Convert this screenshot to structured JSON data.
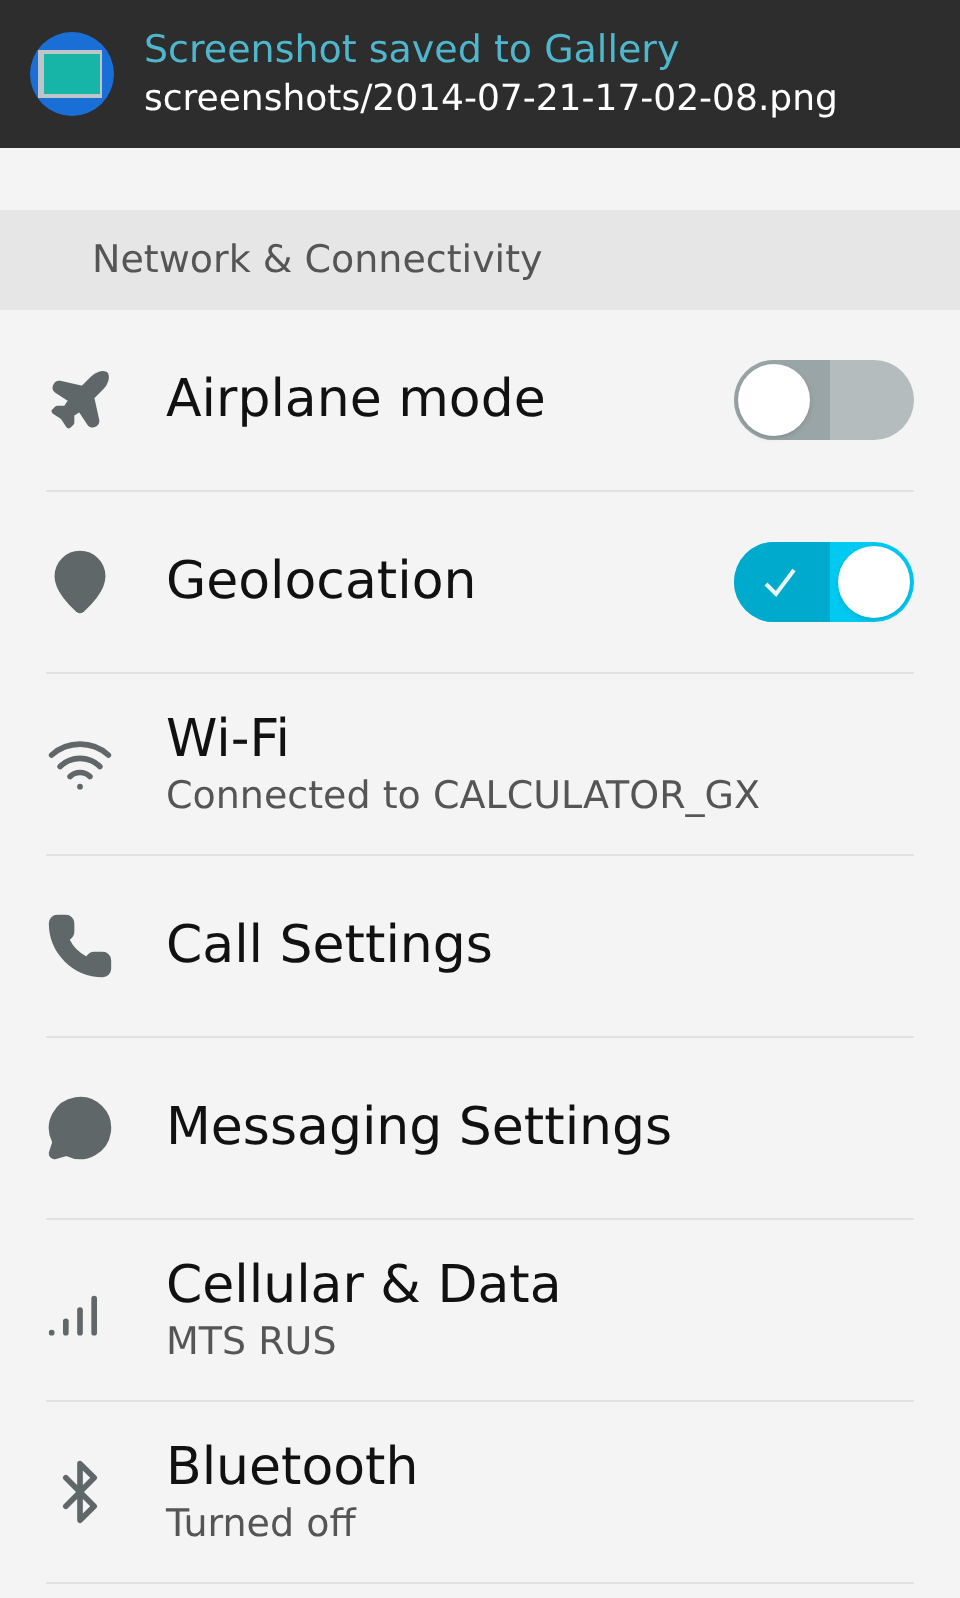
{
  "notification": {
    "title": "Screenshot saved to Gallery",
    "body": "screenshots/2014-07-21-17-02-08.png"
  },
  "section": {
    "header": "Network & Connectivity"
  },
  "items": [
    {
      "kind": "toggle",
      "label": "Airplane mode",
      "on": false
    },
    {
      "kind": "toggle",
      "label": "Geolocation",
      "on": true
    },
    {
      "kind": "link",
      "label": "Wi-Fi",
      "subtitle": "Connected to CALCULATOR_GX"
    },
    {
      "kind": "link",
      "label": "Call Settings"
    },
    {
      "kind": "link",
      "label": "Messaging Settings"
    },
    {
      "kind": "link",
      "label": "Cellular & Data",
      "subtitle": "MTS RUS"
    },
    {
      "kind": "link",
      "label": "Bluetooth",
      "subtitle": "Turned off"
    }
  ]
}
